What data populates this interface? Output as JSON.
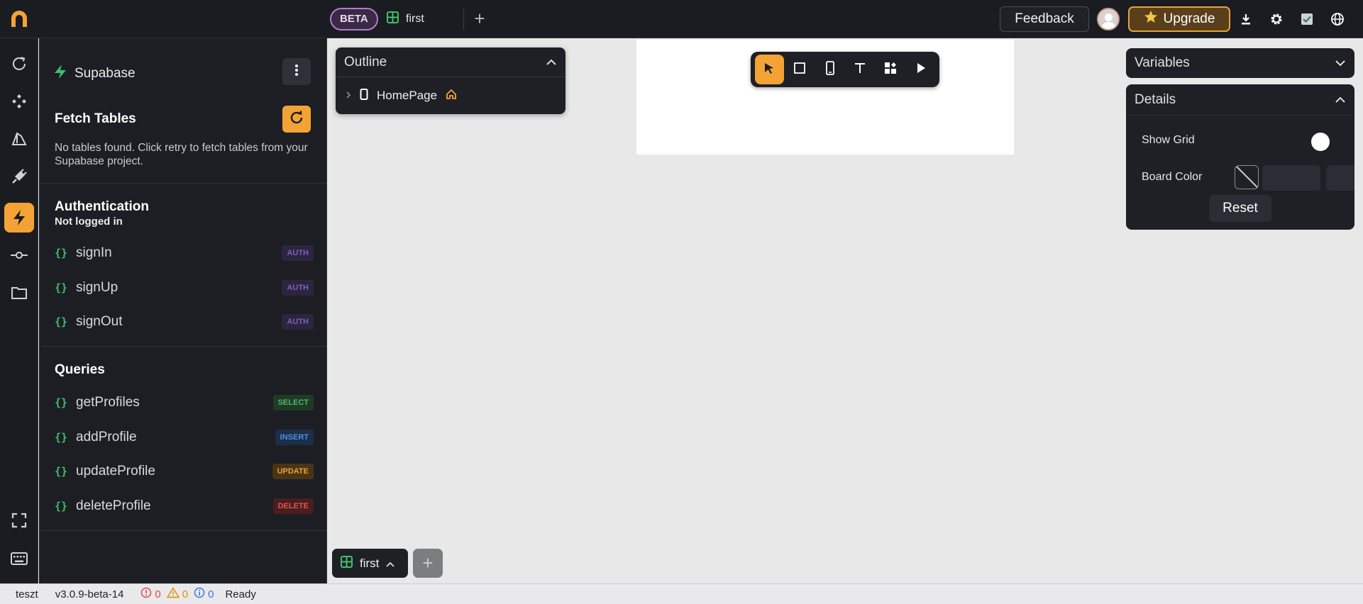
{
  "topbar": {
    "beta_label": "BETA",
    "page_tab": "first",
    "feedback_label": "Feedback",
    "upgrade_label": "Upgrade"
  },
  "sidebar": {
    "integration_name": "Supabase",
    "fetch_title": "Fetch Tables",
    "fetch_desc": "No tables found. Click retry to fetch tables from your Supabase project.",
    "auth": {
      "title": "Authentication",
      "status": "Not logged in",
      "items": [
        {
          "name": "signIn",
          "tag": "AUTH"
        },
        {
          "name": "signUp",
          "tag": "AUTH"
        },
        {
          "name": "signOut",
          "tag": "AUTH"
        }
      ]
    },
    "queries": {
      "title": "Queries",
      "items": [
        {
          "name": "getProfiles",
          "tag": "SELECT"
        },
        {
          "name": "addProfile",
          "tag": "INSERT"
        },
        {
          "name": "updateProfile",
          "tag": "UPDATE"
        },
        {
          "name": "deleteProfile",
          "tag": "DELETE"
        }
      ]
    }
  },
  "outline": {
    "title": "Outline",
    "page_name": "HomePage"
  },
  "right_panel": {
    "variables_title": "Variables",
    "details_title": "Details",
    "show_grid_label": "Show Grid",
    "show_grid_on": false,
    "board_color_label": "Board Color",
    "reset_label": "Reset"
  },
  "bottom": {
    "page_tab": "first"
  },
  "statusbar": {
    "project": "teszt",
    "version": "v3.0.9-beta-14",
    "errors": "0",
    "warnings": "0",
    "infos": "0",
    "state": "Ready"
  },
  "colors": {
    "accent": "#f3a335",
    "brand_green": "#3fbf6a",
    "beta_purple": "#b27ccf"
  }
}
